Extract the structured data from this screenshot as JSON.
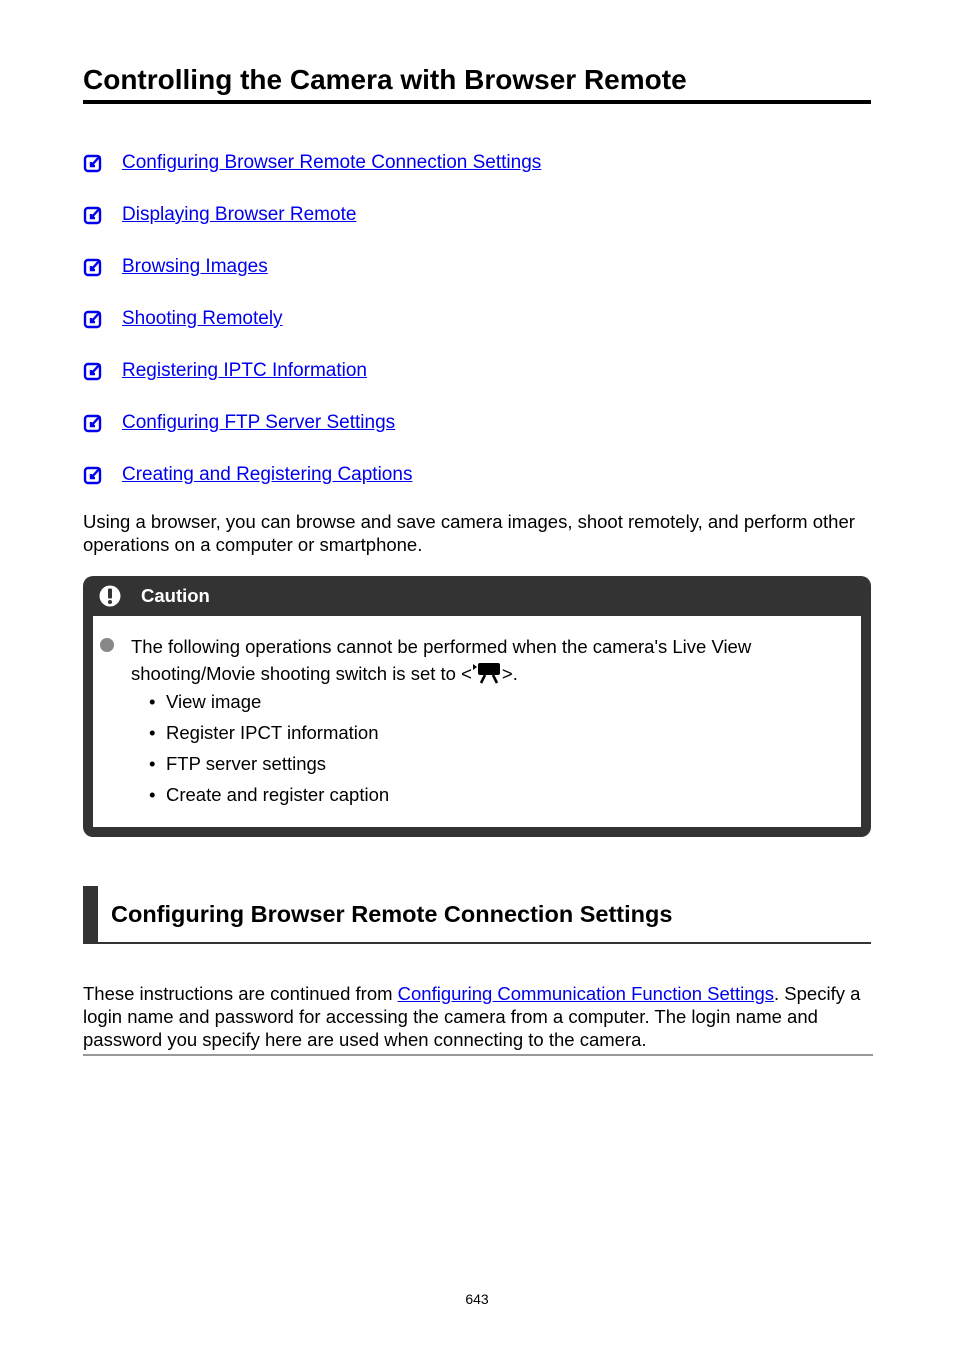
{
  "page_title": "Controlling the Camera with Browser Remote",
  "toc": [
    {
      "label": "Configuring Browser Remote Connection Settings",
      "icon": "checkbox-arrow-icon"
    },
    {
      "label": "Displaying Browser Remote",
      "icon": "checkbox-arrow-icon"
    },
    {
      "label": "Browsing Images",
      "icon": "checkbox-arrow-icon"
    },
    {
      "label": "Shooting Remotely",
      "icon": "checkbox-arrow-icon"
    },
    {
      "label": "Registering IPTC Information",
      "icon": "checkbox-arrow-icon"
    },
    {
      "label": "Configuring FTP Server Settings",
      "icon": "checkbox-arrow-icon"
    },
    {
      "label": "Creating and Registering Captions",
      "icon": "checkbox-arrow-icon"
    }
  ],
  "intro": "Using a browser, you can browse and save camera images, shoot remotely, and perform other operations on a computer or smartphone.",
  "caution": {
    "title": "Caution",
    "icon": "warning-icon",
    "text_before": "The following operations cannot be performed when the camera's Live View shooting/Movie shooting switch is set to <",
    "switch_icon": "movie-camera-icon",
    "text_after": ">.",
    "items": [
      "View image",
      "Register IPCT information",
      "FTP server settings",
      "Create and register caption"
    ]
  },
  "section": {
    "title": "Configuring Browser Remote Connection Settings",
    "text_before": "These instructions are continued from ",
    "link": "Configuring Communication Function Settings",
    "text_after": ". Specify a login name and password for accessing the camera from a computer. The login name and password you specify here are used when connecting to the camera."
  },
  "page_number": "643",
  "colors": {
    "link": "#0000ee",
    "caution_bg": "#333333",
    "bullet": "#888888"
  }
}
